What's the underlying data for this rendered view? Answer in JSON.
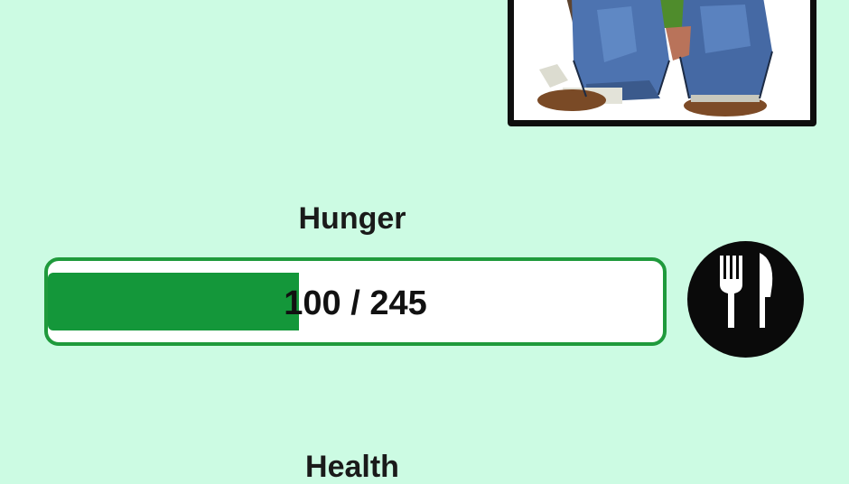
{
  "stats": {
    "hunger": {
      "label": "Hunger",
      "current": 100,
      "max": 245,
      "text": "100 / 245",
      "fill_color": "#14973a",
      "border_color": "#1f9a3c"
    },
    "health": {
      "label": "Health"
    }
  },
  "actions": {
    "eat": {
      "icon": "fork-knife-icon"
    }
  },
  "colors": {
    "background": "#ccfbe3",
    "frame": "#0e0e0e",
    "button": "#0a0a0a"
  }
}
